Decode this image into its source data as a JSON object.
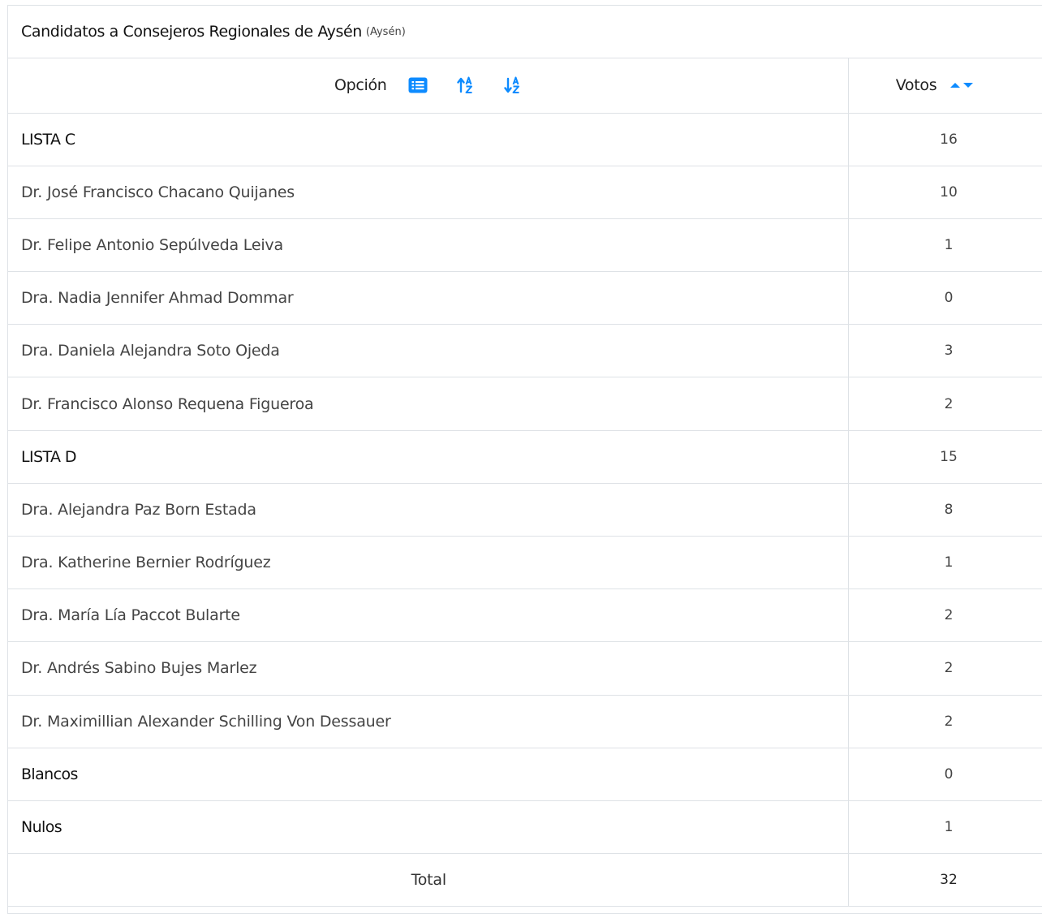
{
  "panel": {
    "title": "Candidatos a Consejeros Regionales de Aysén",
    "region": "(Aysén)"
  },
  "table": {
    "header": {
      "option_label": "Opción",
      "votes_label": "Votos"
    },
    "icons": {
      "list": "list-icon",
      "sort_asc": "sort-alpha-asc-icon",
      "sort_desc": "sort-alpha-desc-icon",
      "votes_up": "caret-up-icon",
      "votes_down": "caret-down-icon"
    },
    "accent_color": "#0d8bff",
    "rows": [
      {
        "name": "LISTA C",
        "votes": "16",
        "group": true
      },
      {
        "name": "Dr. José Francisco Chacano Quijanes",
        "votes": "10",
        "group": false
      },
      {
        "name": "Dr. Felipe Antonio Sepúlveda Leiva",
        "votes": "1",
        "group": false
      },
      {
        "name": "Dra. Nadia Jennifer Ahmad Dommar",
        "votes": "0",
        "group": false
      },
      {
        "name": "Dra. Daniela Alejandra Soto Ojeda",
        "votes": "3",
        "group": false
      },
      {
        "name": "Dr. Francisco Alonso Requena Figueroa",
        "votes": "2",
        "group": false
      },
      {
        "name": "LISTA D",
        "votes": "15",
        "group": true
      },
      {
        "name": "Dra. Alejandra Paz Born Estada",
        "votes": "8",
        "group": false
      },
      {
        "name": "Dra. Katherine Bernier Rodríguez",
        "votes": "1",
        "group": false
      },
      {
        "name": "Dra. María Lía Paccot Bularte",
        "votes": "2",
        "group": false
      },
      {
        "name": "Dr. Andrés Sabino Bujes Marlez",
        "votes": "2",
        "group": false
      },
      {
        "name": "Dr. Maximillian Alexander Schilling Von Dessauer",
        "votes": "2",
        "group": false
      },
      {
        "name": "Blancos",
        "votes": "0",
        "group": true
      },
      {
        "name": "Nulos",
        "votes": "1",
        "group": true
      }
    ],
    "total": {
      "label": "Total",
      "votes": "32"
    }
  }
}
